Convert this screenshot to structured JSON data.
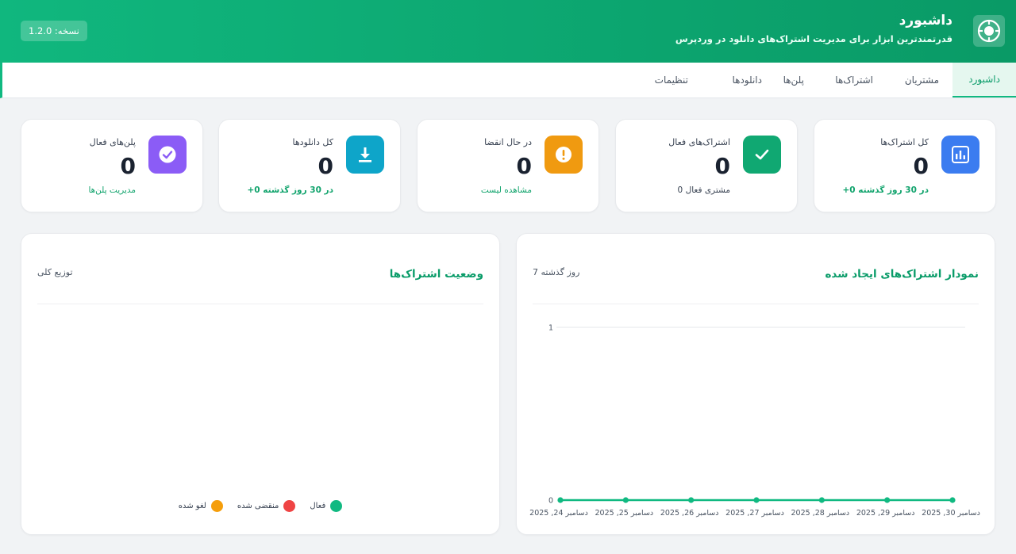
{
  "header": {
    "title": "داشبورد",
    "subtitle": "قدرتمندترین ابزار برای مدیریت اشتراک‌های دانلود در وردپرس",
    "version": "نسخه: 1.2.0",
    "logo_icon": "target-icon"
  },
  "nav": {
    "tabs": [
      {
        "label": "داشبورد",
        "active": true
      },
      {
        "label": "مشتریان",
        "active": false
      },
      {
        "label": "اشتراک‌ها",
        "active": false
      },
      {
        "label": "پلن‌ها",
        "active": false
      },
      {
        "label": "دانلودها",
        "active": false
      },
      {
        "label": "تنظیمات",
        "active": false
      }
    ]
  },
  "stats": [
    {
      "label": "کل اشتراک‌ها",
      "value": "0",
      "footer": "+0  در 30 روز گذشته",
      "icon": "bar-chart-icon",
      "color": "#3b7cf0"
    },
    {
      "label": "اشتراک‌های فعال",
      "value": "0",
      "footer": "0 مشتری فعال",
      "icon": "check-icon",
      "color": "#10a872"
    },
    {
      "label": "در حال انقضا",
      "value": "0",
      "footer": "مشاهده لیست",
      "icon": "alert-icon",
      "color": "#f09a10"
    },
    {
      "label": "کل دانلودها",
      "value": "0",
      "footer": "+0  در 30 روز گذشته",
      "icon": "download-icon",
      "color": "#0ea5c9"
    },
    {
      "label": "پلن‌های فعال",
      "value": "0",
      "footer": "مدیریت پلن‌ها",
      "icon": "check-circle-icon",
      "color": "#8b5cf6"
    }
  ],
  "status_panel": {
    "title": "وضعیت اشتراک‌ها",
    "subtitle": "توزیع کلی",
    "legend": [
      {
        "label": "فعال",
        "color": "#10b981"
      },
      {
        "label": "منقضی شده",
        "color": "#ef4444"
      },
      {
        "label": "لغو شده",
        "color": "#f59e0b"
      }
    ]
  },
  "created_panel": {
    "title": "نمودار اشتراک‌های ایجاد شده",
    "subtitle": "7 روز گذشته"
  },
  "chart_data": {
    "type": "line",
    "categories": [
      "دسامبر 24, 2025",
      "دسامبر 25, 2025",
      "دسامبر 26, 2025",
      "دسامبر 27, 2025",
      "دسامبر 28, 2025",
      "دسامبر 29, 2025",
      "دسامبر 30, 2025"
    ],
    "series": [
      {
        "values": [
          0,
          0,
          0,
          0,
          0,
          0,
          0
        ],
        "color": "#10b981"
      }
    ],
    "ylim": [
      0,
      1
    ],
    "yticks": [
      "0",
      "1"
    ],
    "grid": true
  }
}
